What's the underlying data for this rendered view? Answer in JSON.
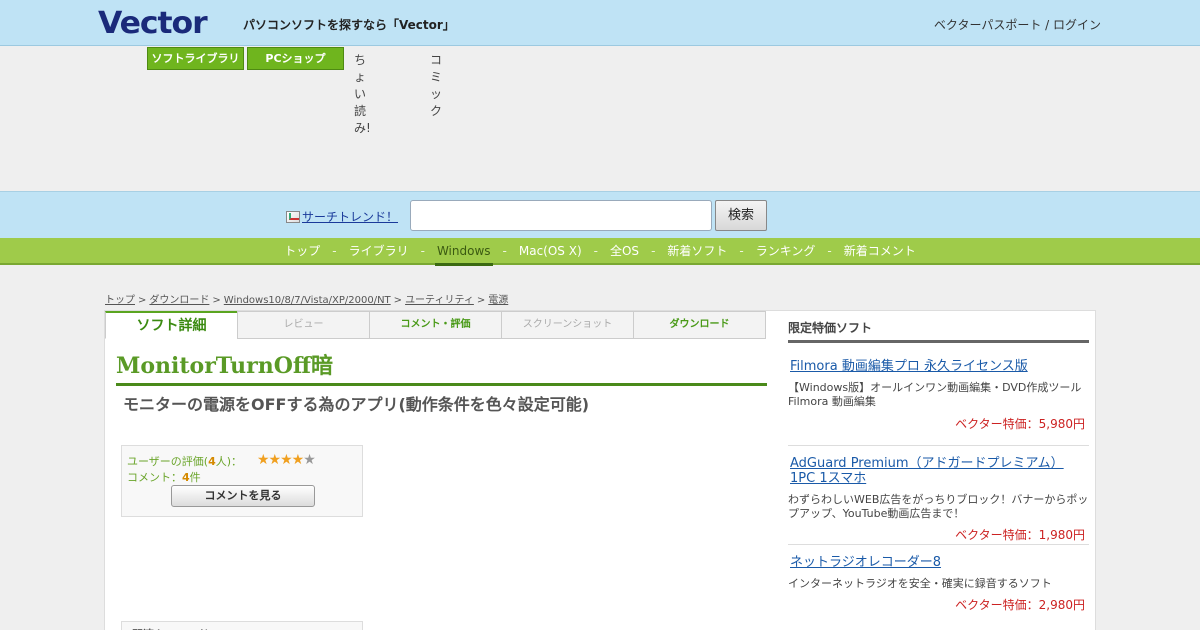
{
  "header": {
    "logo": "Vector",
    "tagline": "パソコンソフトを探すなら「Vector」",
    "login": "ベクターパスポート / ログイン"
  },
  "toptabs": {
    "library": "ソフトライブラリ",
    "pcshop": "PCショップ",
    "link1": "ちょい読み!",
    "link2": "コミック"
  },
  "search": {
    "trend_label": "サーチトレンド！",
    "input_value": "",
    "button_label": "検索"
  },
  "gnav": {
    "items": [
      "トップ",
      "ライブラリ",
      "Windows",
      "Mac(OS X)",
      "全OS",
      "新着ソフト",
      "ランキング",
      "新着コメント"
    ],
    "active": "Windows",
    "separator": "-"
  },
  "breadcrumb": {
    "items": [
      "トップ",
      "ダウンロード",
      "Windows10/8/7/Vista/XP/2000/NT",
      "ユーティリティ",
      "電源"
    ],
    "separator": ">"
  },
  "tabs": {
    "detail": "ソフト詳細",
    "review": "レビュー",
    "comment": "コメント・評価",
    "screenshot": "スクリーンショット",
    "download": "ダウンロード"
  },
  "software": {
    "title": "MonitorTurnOff暗",
    "subtitle": "モニターの電源をOFFする為のアプリ(動作条件を色々設定可能)"
  },
  "rating": {
    "label_prefix": "ユーザーの評価(",
    "count": "4",
    "label_suffix": "人)：",
    "stars_value": 4.5,
    "stars_full": "★★★★",
    "stars_half": "★",
    "comment_prefix": "コメント：",
    "comment_count": "4",
    "comment_suffix": "件",
    "button": "コメントを見る"
  },
  "related": {
    "label": "関連キーワード"
  },
  "sidebar": {
    "heading": "限定特価ソフト",
    "items": [
      {
        "title": "Filmora 動画編集プロ 永久ライセンス版",
        "desc": "【Windows版】オールインワン動画編集・DVD作成ツール Filmora 動画編集",
        "price": "ベクター特価：5,980円"
      },
      {
        "title": "AdGuard Premium（アドガードプレミアム） 1PC 1スマホ",
        "desc": "わずらわしいWEB広告をがっちりブロック！バナーからポップアップ、YouTube動画広告まで！",
        "price": "ベクター特価：1,980円"
      },
      {
        "title": "ネットラジオレコーダー8",
        "desc": "インターネットラジオを安全・確実に録音するソフト",
        "price": "ベクター特価：2,980円"
      }
    ]
  },
  "colors": {
    "header_bg": "#bfe3f5",
    "nav_green": "#9fcb4a",
    "accent_green": "#5a9a26",
    "price_red": "#cc2222",
    "link_blue": "#1a5aa8"
  }
}
